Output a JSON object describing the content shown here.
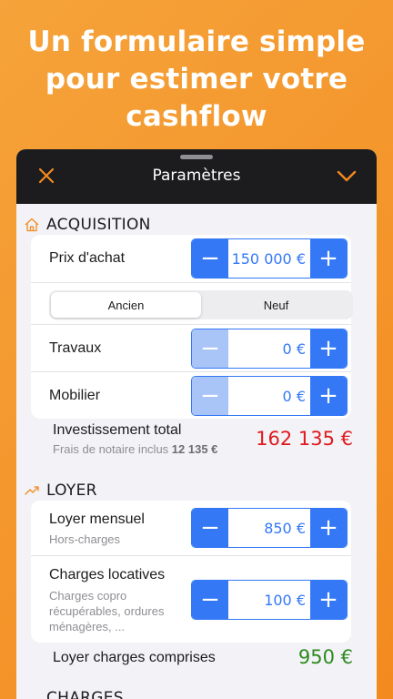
{
  "headline": {
    "line1": "Un formulaire simple",
    "line2": "pour estimer votre",
    "line3": "cashflow"
  },
  "navbar": {
    "title": "Paramètres",
    "close_icon": "x-icon",
    "confirm_icon": "chevron-down-icon"
  },
  "colors": {
    "accent": "#f38a1f",
    "stepper_blue": "#3478f6",
    "total_red": "#e0191c",
    "total_green": "#2e8b1e"
  },
  "acquisition": {
    "title": "ACQUISITION",
    "icon": "home-icon",
    "prix_achat": {
      "label": "Prix d'achat",
      "value": "150 000 €",
      "minus": "−",
      "plus": "+"
    },
    "condition": {
      "options": [
        "Ancien",
        "Neuf"
      ],
      "selected": "Ancien"
    },
    "travaux": {
      "label": "Travaux",
      "value": "0 €",
      "minus": "−",
      "plus": "+"
    },
    "mobilier": {
      "label": "Mobilier",
      "value": "0 €",
      "minus": "−",
      "plus": "+"
    },
    "total": {
      "label": "Investissement total",
      "sub_prefix": "Frais de notaire inclus ",
      "sub_amount": "12 135 €",
      "value": "162 135 €"
    }
  },
  "loyer": {
    "title": "LOYER",
    "icon": "trend-up-icon",
    "mensuel": {
      "label": "Loyer mensuel",
      "sub": "Hors-charges",
      "value": "850 €",
      "minus": "−",
      "plus": "+"
    },
    "charges": {
      "label": "Charges locatives",
      "sub_line1": "Charges copro",
      "sub_line2": "récupérables, ordures",
      "sub_line3": "ménagères, ...",
      "value": "100 €",
      "minus": "−",
      "plus": "+"
    },
    "total": {
      "label": "Loyer charges comprises",
      "value": "950 €"
    }
  },
  "next_section": {
    "title": "CHARGES"
  }
}
